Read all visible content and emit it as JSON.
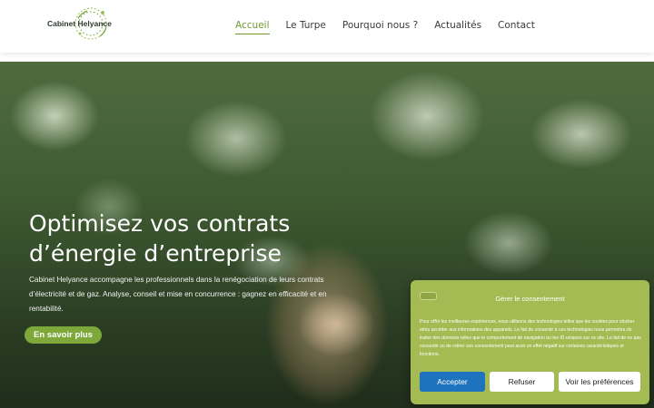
{
  "header": {
    "logo_text": "Cabinet Helyance",
    "nav": [
      {
        "label": "Accueil",
        "active": true
      },
      {
        "label": "Le Turpe",
        "active": false
      },
      {
        "label": "Pourquoi nous ?",
        "active": false
      },
      {
        "label": "Actualités",
        "active": false
      },
      {
        "label": "Contact",
        "active": false
      }
    ]
  },
  "hero": {
    "title_line1": "Optimisez vos contrats",
    "title_line2": "d’énergie d’entreprise",
    "description": "Cabinet Helyance accompagne les professionnels dans la renégociation de leurs contrats d’électricité et de gaz. Analyse, conseil et mise en concurrence : gagnez en efficacité et en rentabilité.",
    "cta_label": "En savoir plus"
  },
  "consent": {
    "title": "Gérer le consentement",
    "text": "Pour offrir les meilleures expériences, nous utilisons des technologies telles que les cookies pour stocker et/ou accéder aux informations des appareils. Le fait de consentir à ces technologies nous permettra de traiter des données telles que le comportement de navigation ou les ID uniques sur ce site. Le fait de ne pas consentir ou de retirer son consentement peut avoir un effet négatif sur certaines caractéristiques et fonctions.",
    "accept_label": "Accepter",
    "refuse_label": "Refuser",
    "prefs_label": "Voir les préférences"
  },
  "colors": {
    "accent_green": "#6f9a2f",
    "cta_green": "#7ea83a",
    "consent_bg": "#a3bb52",
    "accept_blue": "#1e73be"
  }
}
